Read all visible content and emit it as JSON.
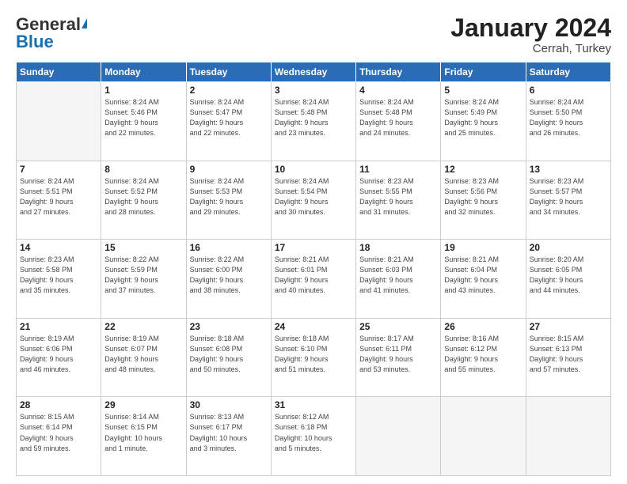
{
  "header": {
    "logo_general": "General",
    "logo_blue": "Blue",
    "title": "January 2024",
    "subtitle": "Cerrah, Turkey"
  },
  "days_of_week": [
    "Sunday",
    "Monday",
    "Tuesday",
    "Wednesday",
    "Thursday",
    "Friday",
    "Saturday"
  ],
  "weeks": [
    [
      {
        "day": "",
        "info": ""
      },
      {
        "day": "1",
        "info": "Sunrise: 8:24 AM\nSunset: 5:46 PM\nDaylight: 9 hours\nand 22 minutes."
      },
      {
        "day": "2",
        "info": "Sunrise: 8:24 AM\nSunset: 5:47 PM\nDaylight: 9 hours\nand 22 minutes."
      },
      {
        "day": "3",
        "info": "Sunrise: 8:24 AM\nSunset: 5:48 PM\nDaylight: 9 hours\nand 23 minutes."
      },
      {
        "day": "4",
        "info": "Sunrise: 8:24 AM\nSunset: 5:48 PM\nDaylight: 9 hours\nand 24 minutes."
      },
      {
        "day": "5",
        "info": "Sunrise: 8:24 AM\nSunset: 5:49 PM\nDaylight: 9 hours\nand 25 minutes."
      },
      {
        "day": "6",
        "info": "Sunrise: 8:24 AM\nSunset: 5:50 PM\nDaylight: 9 hours\nand 26 minutes."
      }
    ],
    [
      {
        "day": "7",
        "info": "Sunrise: 8:24 AM\nSunset: 5:51 PM\nDaylight: 9 hours\nand 27 minutes."
      },
      {
        "day": "8",
        "info": "Sunrise: 8:24 AM\nSunset: 5:52 PM\nDaylight: 9 hours\nand 28 minutes."
      },
      {
        "day": "9",
        "info": "Sunrise: 8:24 AM\nSunset: 5:53 PM\nDaylight: 9 hours\nand 29 minutes."
      },
      {
        "day": "10",
        "info": "Sunrise: 8:24 AM\nSunset: 5:54 PM\nDaylight: 9 hours\nand 30 minutes."
      },
      {
        "day": "11",
        "info": "Sunrise: 8:23 AM\nSunset: 5:55 PM\nDaylight: 9 hours\nand 31 minutes."
      },
      {
        "day": "12",
        "info": "Sunrise: 8:23 AM\nSunset: 5:56 PM\nDaylight: 9 hours\nand 32 minutes."
      },
      {
        "day": "13",
        "info": "Sunrise: 8:23 AM\nSunset: 5:57 PM\nDaylight: 9 hours\nand 34 minutes."
      }
    ],
    [
      {
        "day": "14",
        "info": "Sunrise: 8:23 AM\nSunset: 5:58 PM\nDaylight: 9 hours\nand 35 minutes."
      },
      {
        "day": "15",
        "info": "Sunrise: 8:22 AM\nSunset: 5:59 PM\nDaylight: 9 hours\nand 37 minutes."
      },
      {
        "day": "16",
        "info": "Sunrise: 8:22 AM\nSunset: 6:00 PM\nDaylight: 9 hours\nand 38 minutes."
      },
      {
        "day": "17",
        "info": "Sunrise: 8:21 AM\nSunset: 6:01 PM\nDaylight: 9 hours\nand 40 minutes."
      },
      {
        "day": "18",
        "info": "Sunrise: 8:21 AM\nSunset: 6:03 PM\nDaylight: 9 hours\nand 41 minutes."
      },
      {
        "day": "19",
        "info": "Sunrise: 8:21 AM\nSunset: 6:04 PM\nDaylight: 9 hours\nand 43 minutes."
      },
      {
        "day": "20",
        "info": "Sunrise: 8:20 AM\nSunset: 6:05 PM\nDaylight: 9 hours\nand 44 minutes."
      }
    ],
    [
      {
        "day": "21",
        "info": "Sunrise: 8:19 AM\nSunset: 6:06 PM\nDaylight: 9 hours\nand 46 minutes."
      },
      {
        "day": "22",
        "info": "Sunrise: 8:19 AM\nSunset: 6:07 PM\nDaylight: 9 hours\nand 48 minutes."
      },
      {
        "day": "23",
        "info": "Sunrise: 8:18 AM\nSunset: 6:08 PM\nDaylight: 9 hours\nand 50 minutes."
      },
      {
        "day": "24",
        "info": "Sunrise: 8:18 AM\nSunset: 6:10 PM\nDaylight: 9 hours\nand 51 minutes."
      },
      {
        "day": "25",
        "info": "Sunrise: 8:17 AM\nSunset: 6:11 PM\nDaylight: 9 hours\nand 53 minutes."
      },
      {
        "day": "26",
        "info": "Sunrise: 8:16 AM\nSunset: 6:12 PM\nDaylight: 9 hours\nand 55 minutes."
      },
      {
        "day": "27",
        "info": "Sunrise: 8:15 AM\nSunset: 6:13 PM\nDaylight: 9 hours\nand 57 minutes."
      }
    ],
    [
      {
        "day": "28",
        "info": "Sunrise: 8:15 AM\nSunset: 6:14 PM\nDaylight: 9 hours\nand 59 minutes."
      },
      {
        "day": "29",
        "info": "Sunrise: 8:14 AM\nSunset: 6:15 PM\nDaylight: 10 hours\nand 1 minute."
      },
      {
        "day": "30",
        "info": "Sunrise: 8:13 AM\nSunset: 6:17 PM\nDaylight: 10 hours\nand 3 minutes."
      },
      {
        "day": "31",
        "info": "Sunrise: 8:12 AM\nSunset: 6:18 PM\nDaylight: 10 hours\nand 5 minutes."
      },
      {
        "day": "",
        "info": ""
      },
      {
        "day": "",
        "info": ""
      },
      {
        "day": "",
        "info": ""
      }
    ]
  ]
}
